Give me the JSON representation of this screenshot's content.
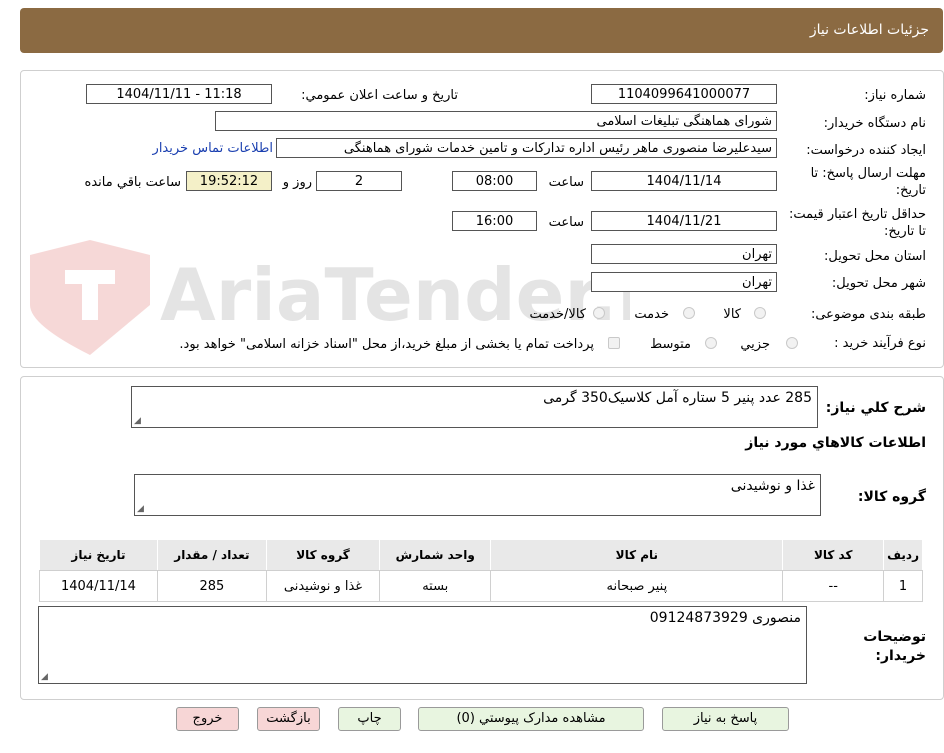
{
  "header": {
    "title": "جزئیات اطلاعات نیاز"
  },
  "watermark": {
    "text": "AriaTender.net",
    "color": "#d9534f"
  },
  "form": {
    "need_number": {
      "label": "شماره نیاز:",
      "value": "1104099641000077"
    },
    "announce": {
      "label": "تاریخ و ساعت اعلان عمومي:",
      "value": "1404/11/11 - 11:18"
    },
    "buyer_org": {
      "label": "نام دستگاه خریدار:",
      "value": "شورای هماهنگی تبلیغات اسلامی"
    },
    "requester": {
      "label": "ایجاد کننده درخواست:",
      "value": "سیدعلیرضا منصوری ماهر رئیس اداره تدارکات و تامین خدمات  شورای هماهنگی",
      "contact_link": "اطلاعات تماس خریدار"
    },
    "deadline": {
      "label": "مهلت ارسال پاسخ: تا تاریخ:",
      "date": "1404/11/14",
      "time_label": "ساعت",
      "time": "08:00",
      "days": "2",
      "days_label": "روز و",
      "remaining": "19:52:12",
      "remaining_label": "ساعت باقي مانده"
    },
    "validity": {
      "label": "حداقل تاریخ اعتبار قیمت: تا تاریخ:",
      "date": "1404/11/21",
      "time_label": "ساعت",
      "time": "16:00"
    },
    "province": {
      "label": "استان محل تحویل:",
      "value": "تهران"
    },
    "city": {
      "label": "شهر محل تحویل:",
      "value": "تهران"
    },
    "category": {
      "label": "طبقه بندی موضوعی:",
      "options": [
        "کالا",
        "خدمت",
        "کالا/خدمت"
      ]
    },
    "process": {
      "label": "نوع فرآیند خرید :",
      "options": [
        "جزیي",
        "متوسط"
      ],
      "payment_note": "پرداخت تمام یا بخشی از مبلغ خرید،از محل \"اسناد خزانه اسلامی\" خواهد بود."
    }
  },
  "details": {
    "summary_label": "شرح کلي نیاز:",
    "summary_value": "285 عدد پنیر 5 ستاره آمل  کلاسیک350 گرمی",
    "goods_info_title": "اطلاعات کالاهاي مورد نیاز",
    "goods_group_label": "گروه کالا:",
    "goods_group_value": "غذا و نوشیدنی",
    "table": {
      "headers": [
        "ردیف",
        "کد کالا",
        "نام کالا",
        "واحد شمارش",
        "گروه کالا",
        "تعداد / مقدار",
        "تاریخ نیاز"
      ],
      "rows": [
        [
          "1",
          "--",
          "پنیر صبحانه",
          "بسته",
          "غذا و نوشیدنی",
          "285",
          "1404/11/14"
        ]
      ]
    },
    "buyer_notes_label": "توضیحات خریدار:",
    "buyer_notes_value": "منصوری 09124873929"
  },
  "buttons": {
    "reply": "پاسخ به نیاز",
    "attachments": "مشاهده مدارک پیوستي (0)",
    "print": "چاپ",
    "back": "بازگشت",
    "exit": "خروج"
  }
}
